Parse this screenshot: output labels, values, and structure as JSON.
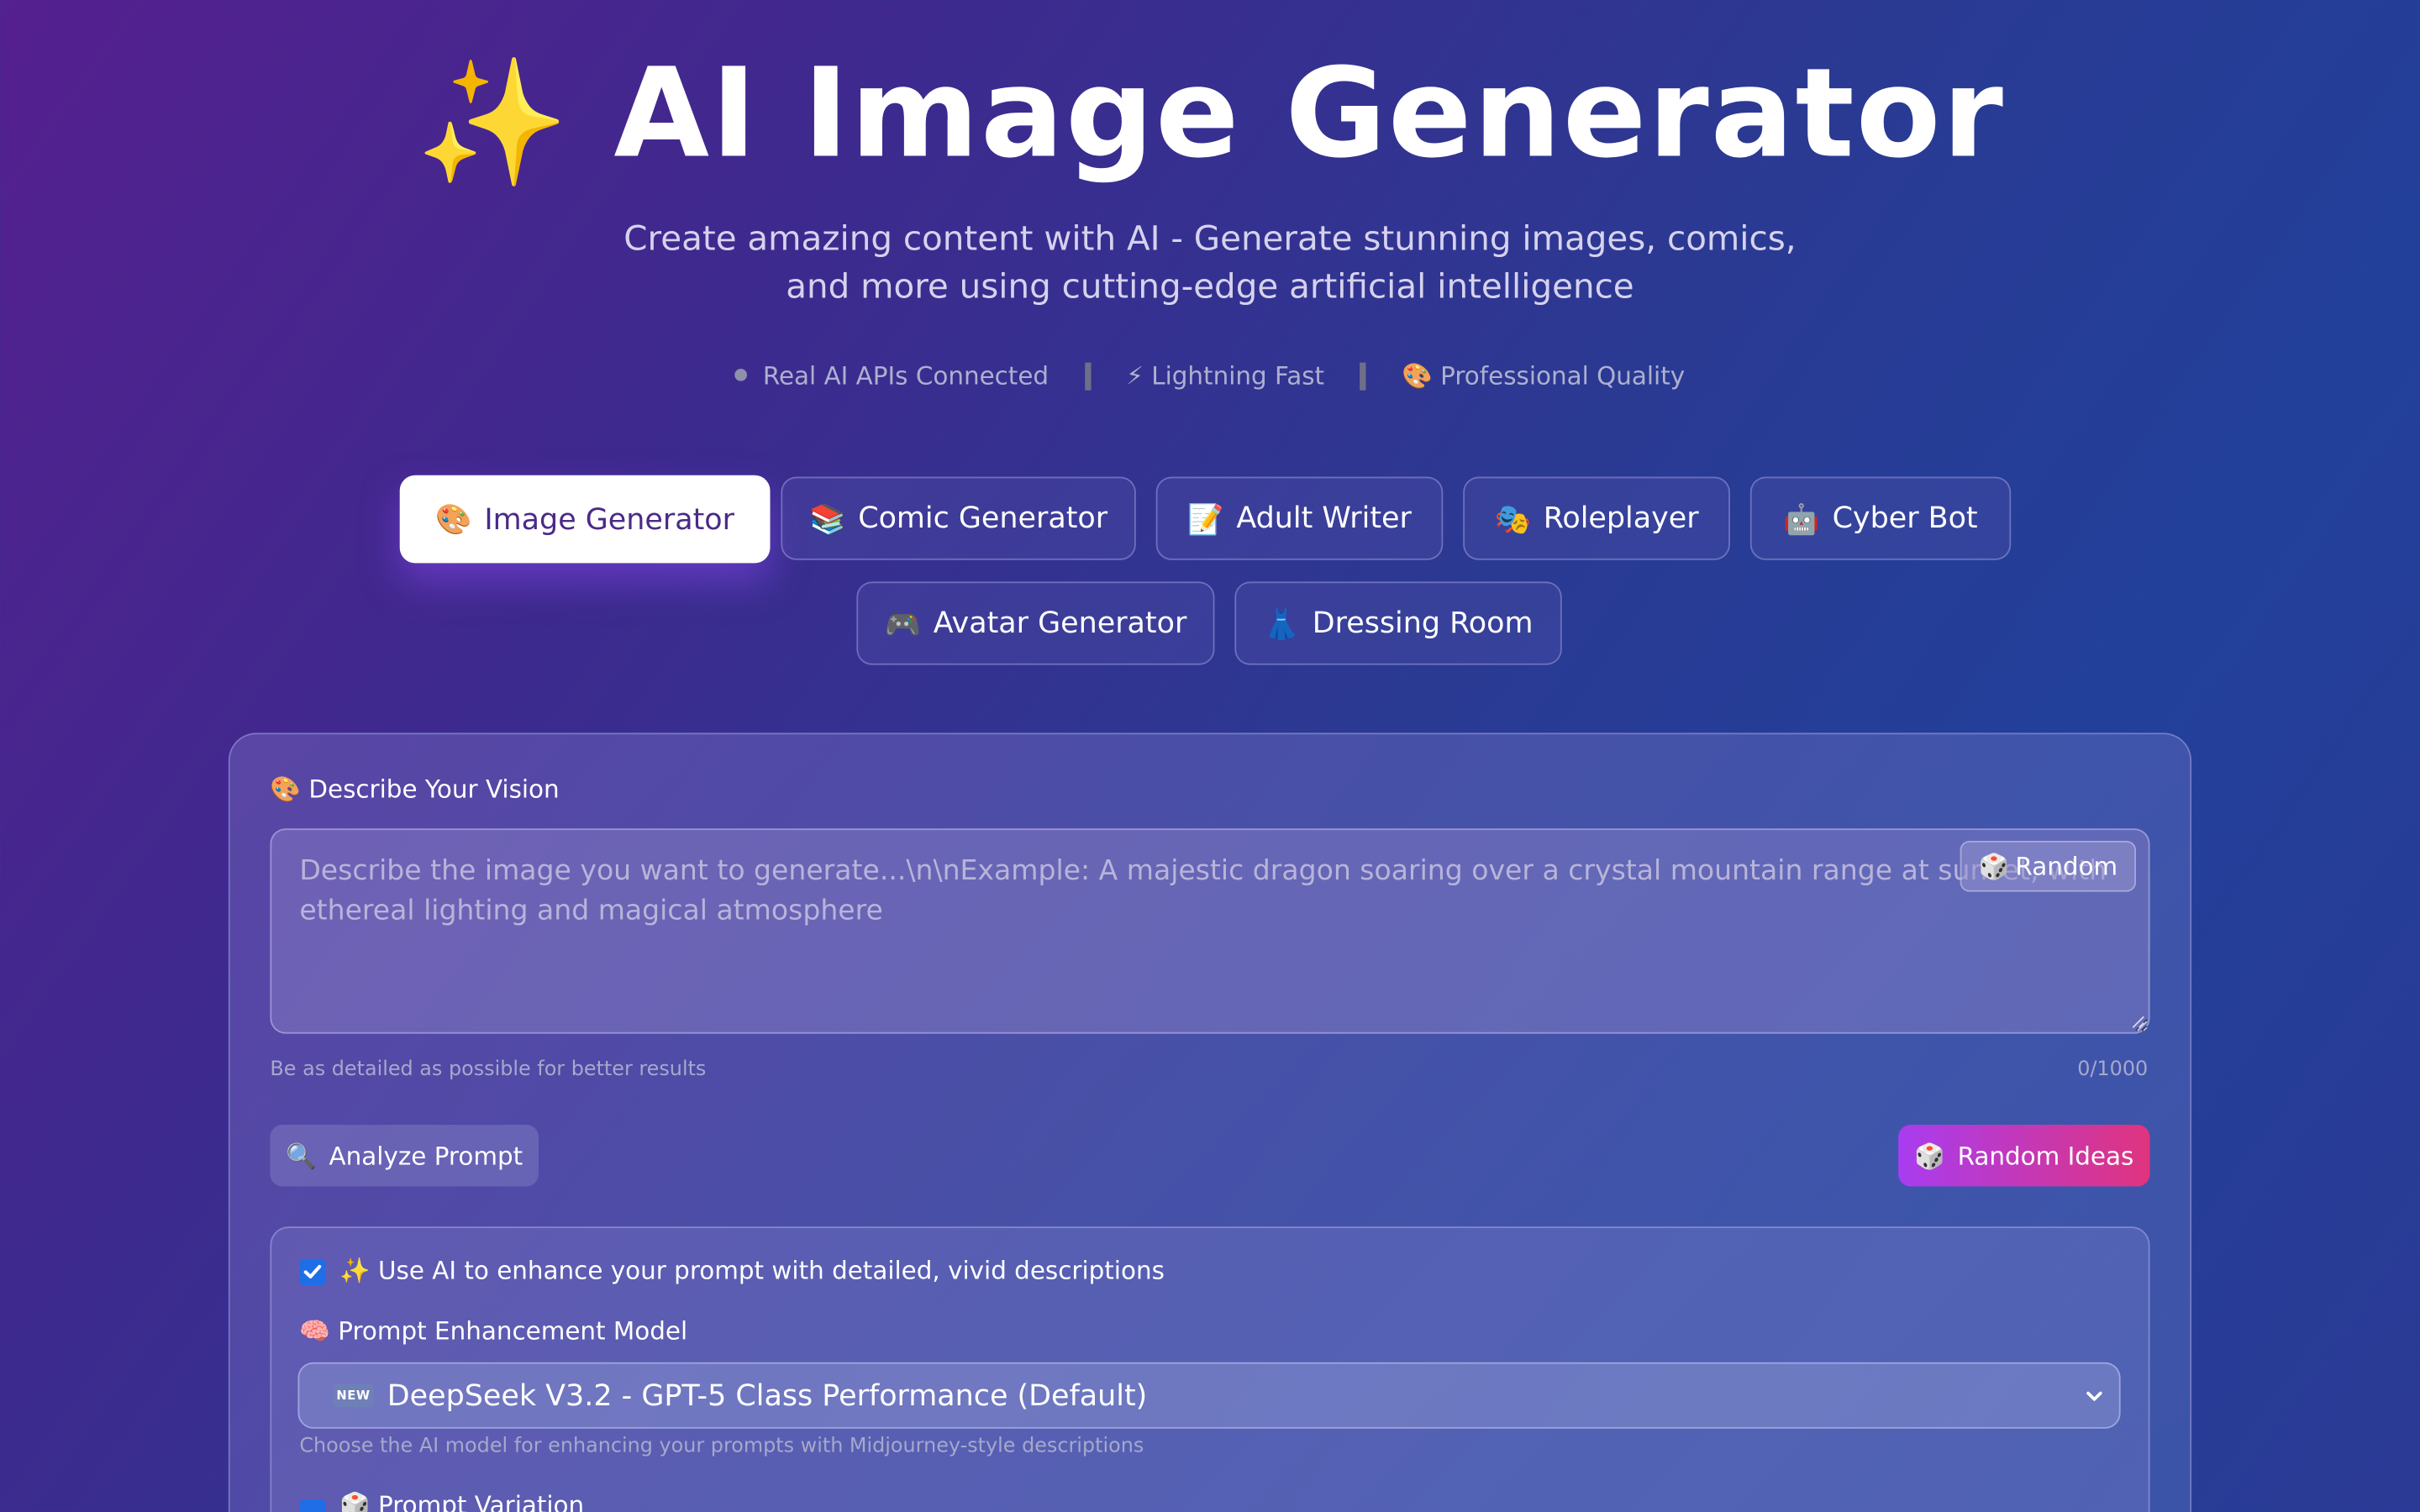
{
  "header": {
    "title_icon": "✨",
    "title": "AI Image Generator",
    "subtitle": "Create amazing content with AI - Generate stunning images, comics, and more using cutting-edge artificial intelligence",
    "features": [
      {
        "icon": "status-dot",
        "label": "Real AI APIs Connected"
      },
      {
        "icon": "⚡",
        "label": "Lightning Fast"
      },
      {
        "icon": "🎨",
        "label": "Professional Quality"
      }
    ]
  },
  "tabs": [
    {
      "icon": "🎨",
      "label": "Image Generator",
      "active": true
    },
    {
      "icon": "📚",
      "label": "Comic Generator"
    },
    {
      "icon": "📝",
      "label": "Adult Writer"
    },
    {
      "icon": "🎭",
      "label": "Roleplayer"
    },
    {
      "icon": "🤖",
      "label": "Cyber Bot"
    },
    {
      "icon": "🎮",
      "label": "Avatar Generator"
    },
    {
      "icon": "👗",
      "label": "Dressing Room"
    }
  ],
  "form": {
    "vision_label_icon": "🎨",
    "vision_label": "Describe Your Vision",
    "prompt_value": "",
    "prompt_placeholder": "Describe the image you want to generate...\\n\\nExample: A majestic dragon soaring over a crystal mountain range at sunset, with ethereal lighting and magical atmosphere",
    "random_icon": "🎲",
    "random_label": "Random",
    "prompt_hint": "Be as detailed as possible for better results",
    "char_count": "0/1000",
    "analyze_icon": "🔍",
    "analyze_label": "Analyze Prompt",
    "ideas_icon": "🎲",
    "ideas_label": "Random Ideas"
  },
  "enhance": {
    "enabled": true,
    "checkbox_label": "✨ Use AI to enhance your prompt with detailed, vivid descriptions",
    "model_label_icon": "🧠",
    "model_label": "Prompt Enhancement Model",
    "model_badge": "NEW",
    "model_value": "DeepSeek V3.2 - GPT-5 Class Performance (Default)",
    "model_hint": "Choose the AI model for enhancing your prompts with Midjourney-style descriptions",
    "variation_icon": "🎲",
    "variation_label": "Prompt Variation"
  },
  "colors": {
    "accent_gradient_start": "#a83cf0",
    "accent_gradient_end": "#e0347e",
    "checkbox": "#1f6ee8",
    "active_tab_text": "#4a2a88"
  }
}
